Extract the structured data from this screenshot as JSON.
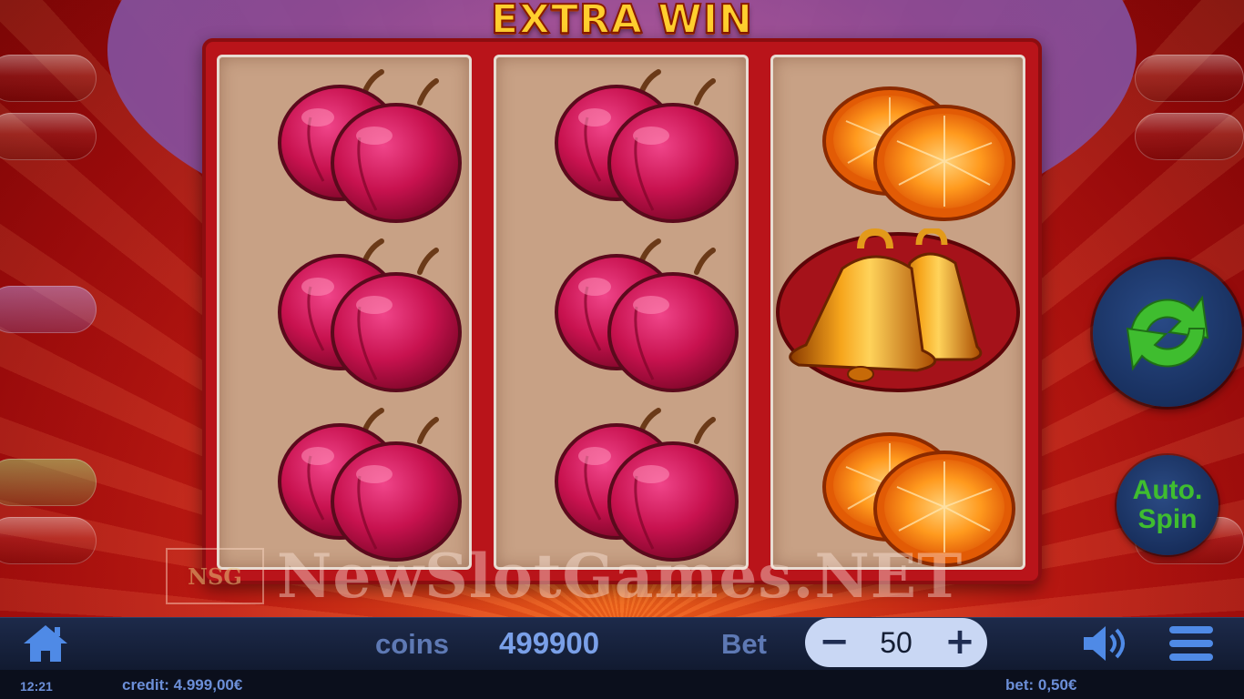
{
  "game": {
    "title": "EXTRA WIN",
    "watermark_logo": "NSG",
    "watermark_text": "NewSlotGames.NET"
  },
  "reels": [
    [
      "plum-icon",
      "plum-icon",
      "plum-icon"
    ],
    [
      "plum-icon",
      "plum-icon",
      "plum-icon"
    ],
    [
      "orange-icon",
      "bell-icon",
      "orange-icon"
    ]
  ],
  "controls": {
    "spin_icon": "refresh-arrows-icon",
    "auto_spin_label_1": "Auto.",
    "auto_spin_label_2": "Spin"
  },
  "bottom_bar": {
    "coins_label": "coins",
    "coins_value": "499900",
    "bet_label": "Bet",
    "bet_minus": "−",
    "bet_value": "50",
    "bet_plus": "+"
  },
  "status_bar": {
    "time": "12:21",
    "credit": "credit: 4.999,00€",
    "bet": "bet: 0,50€"
  },
  "colors": {
    "accent_green": "#3fbd2f",
    "bar_blue": "#1d2a4a",
    "title_gold": "#ffcf2e"
  }
}
